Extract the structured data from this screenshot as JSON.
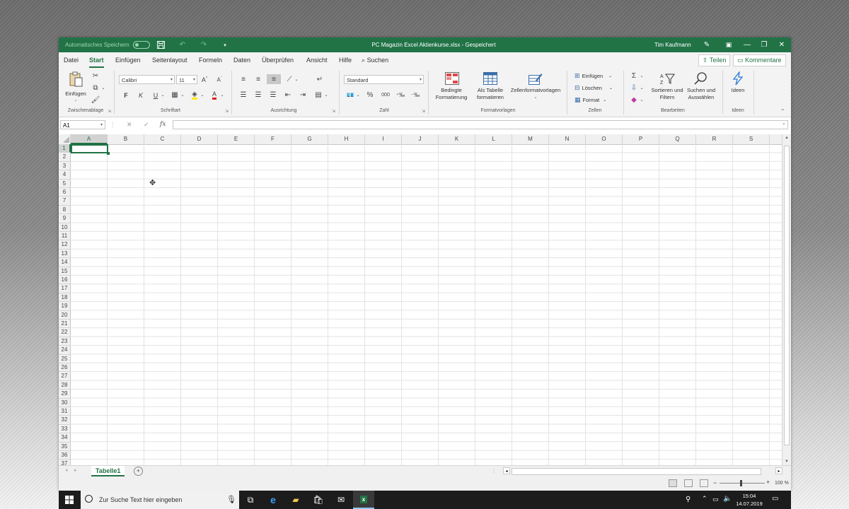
{
  "titlebar": {
    "autosave_label": "Automatisches Speichern",
    "autosave_state": "Aus",
    "title": "PC Magazin Excel Aktienkurse.xlsx  -  Gespeichert",
    "user": "Tim Kaufmann"
  },
  "menu": {
    "items": [
      "Datei",
      "Start",
      "Einfügen",
      "Seitenlayout",
      "Formeln",
      "Daten",
      "Überprüfen",
      "Ansicht",
      "Hilfe"
    ],
    "active": "Start",
    "search_label": "Suchen",
    "share_label": "Teilen",
    "comments_label": "Kommentare"
  },
  "ribbon": {
    "clipboard": {
      "paste_label": "Einfügen",
      "group_label": "Zwischenablage"
    },
    "font": {
      "font_name": "Calibri",
      "font_size": "11",
      "bold": "F",
      "italic": "K",
      "underline": "U",
      "group_label": "Schriftart"
    },
    "alignment": {
      "group_label": "Ausrichtung"
    },
    "number": {
      "format": "Standard",
      "percent": "%",
      "thousands": "000",
      "group_label": "Zahl"
    },
    "styles": {
      "conditional_label_1": "Bedingte",
      "conditional_label_2": "Formatierung",
      "table_label_1": "Als Tabelle",
      "table_label_2": "formatieren",
      "cell_styles_label": "Zellenformatvorlagen",
      "group_label": "Formatvorlagen"
    },
    "cells": {
      "insert_label": "Einfügen",
      "delete_label": "Löschen",
      "format_label": "Format",
      "group_label": "Zellen"
    },
    "editing": {
      "sort_label_1": "Sortieren und",
      "sort_label_2": "Filtern",
      "find_label_1": "Suchen und",
      "find_label_2": "Auswählen",
      "group_label": "Bearbeiten"
    },
    "ideas": {
      "ideas_label": "Ideen",
      "group_label": "Ideen"
    }
  },
  "formula_bar": {
    "name_box": "A1",
    "fx": "fx",
    "value": ""
  },
  "grid": {
    "columns": [
      "A",
      "B",
      "C",
      "D",
      "E",
      "F",
      "G",
      "H",
      "I",
      "J",
      "K",
      "L",
      "M",
      "N",
      "O",
      "P",
      "Q",
      "R",
      "S"
    ],
    "rows": [
      "1",
      "2",
      "3",
      "4",
      "5",
      "6",
      "7",
      "8",
      "9",
      "10",
      "11",
      "12",
      "13",
      "14",
      "15",
      "16",
      "17",
      "18",
      "19",
      "20",
      "21",
      "22",
      "23",
      "24",
      "25",
      "26",
      "27",
      "28",
      "29",
      "30",
      "31",
      "32",
      "33",
      "34",
      "35",
      "36",
      "37"
    ],
    "selected_cell": "A1"
  },
  "sheets": {
    "tabs": [
      "Tabelle1"
    ],
    "active": "Tabelle1"
  },
  "status": {
    "zoom": "100 %"
  },
  "taskbar": {
    "search_placeholder": "Zur Suche Text hier eingeben",
    "time": "15:04",
    "date": "14.07.2019"
  },
  "colors": {
    "excel_green": "#217346",
    "ribbon_bg": "#f3f3f3",
    "taskbar_bg": "#1c1c1c"
  }
}
